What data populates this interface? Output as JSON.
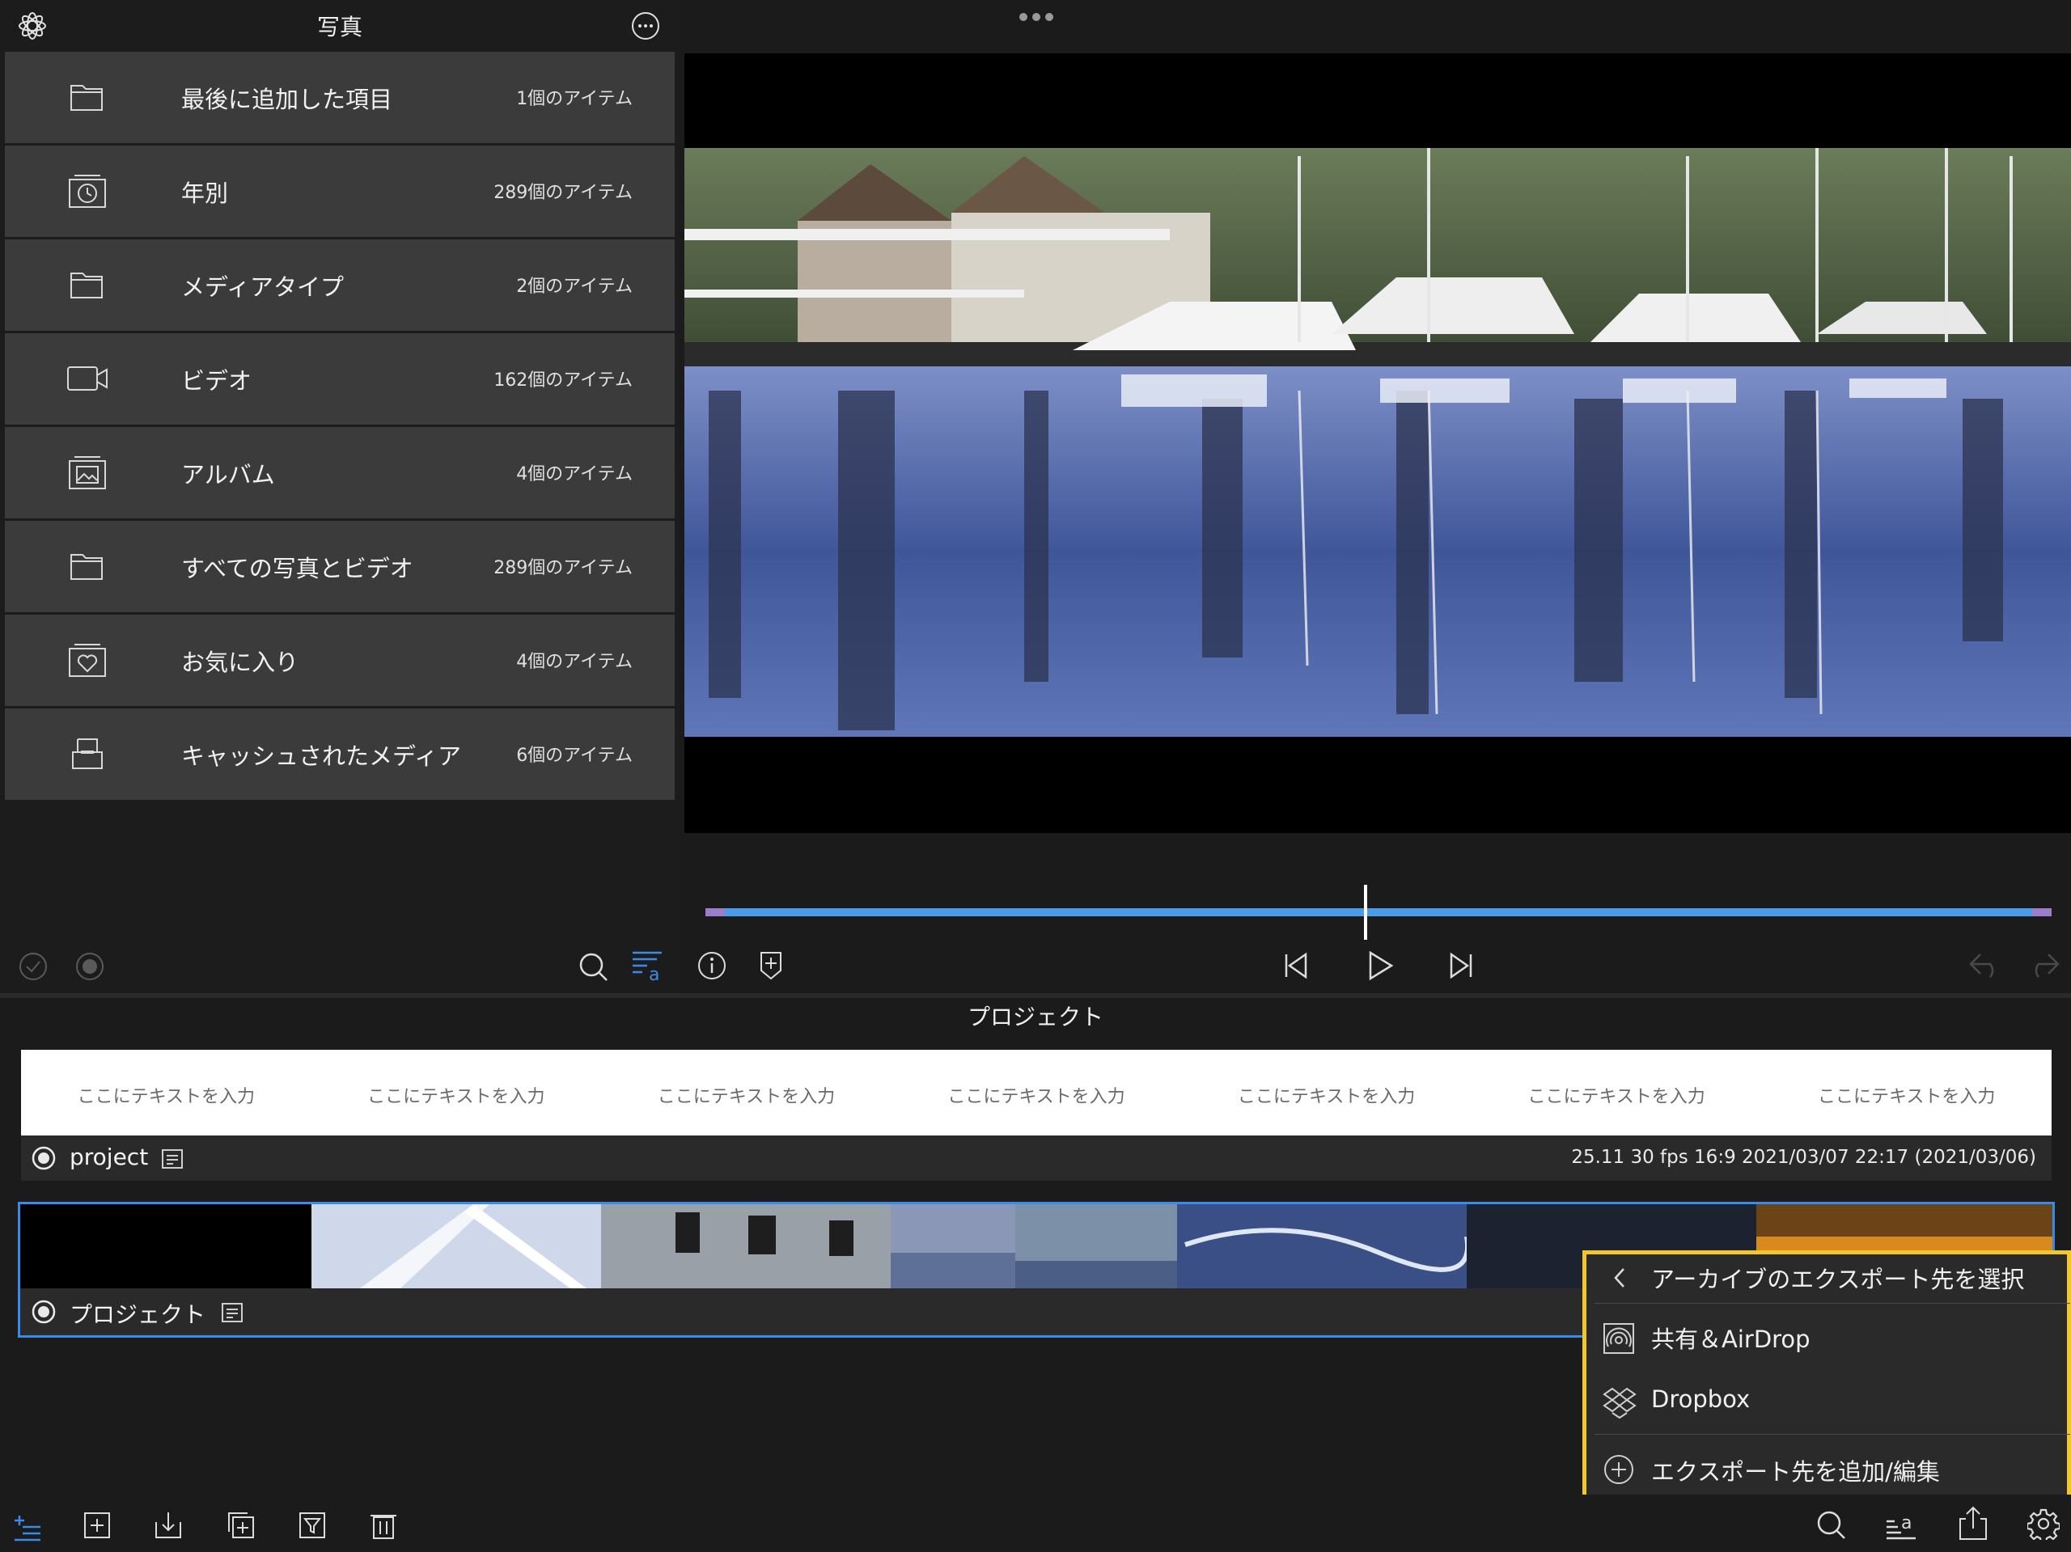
{
  "browser": {
    "title": "写真",
    "items": [
      {
        "label": "最後に追加した項目",
        "count": "1個のアイテム",
        "icon": "folder-icon"
      },
      {
        "label": "年別",
        "count": "289個のアイテム",
        "icon": "clock-stack-icon"
      },
      {
        "label": "メディアタイプ",
        "count": "2個のアイテム",
        "icon": "folder-icon"
      },
      {
        "label": "ビデオ",
        "count": "162個のアイテム",
        "icon": "video-camera-icon"
      },
      {
        "label": "アルバム",
        "count": "4個のアイテム",
        "icon": "photo-album-icon"
      },
      {
        "label": "すべての写真とビデオ",
        "count": "289個のアイテム",
        "icon": "folder-icon"
      },
      {
        "label": "お気に入り",
        "count": "4個のアイテム",
        "icon": "heart-stack-icon"
      },
      {
        "label": "キャッシュされたメディア",
        "count": "6個のアイテム",
        "icon": "tray-icon"
      }
    ]
  },
  "project": {
    "title": "プロジェクト",
    "title_strip": [
      "ここにテキストを入力",
      "ここにテキストを入力",
      "ここにテキストを入力",
      "ここにテキストを入力",
      "ここにテキストを入力",
      "ここにテキストを入力",
      "ここにテキストを入力"
    ],
    "row1": {
      "name": "project",
      "meta": "25.11   30 fps   16:9   2021/03/07 22:17   (2021/03/06)"
    },
    "row2": {
      "name": "プロジェクト"
    }
  },
  "export_popover": {
    "header": "アーカイブのエクスポート先を選択",
    "share": "共有＆AirDrop",
    "dropbox": "Dropbox",
    "add_edit": "エクスポート先を追加/編集"
  },
  "colors": {
    "accent": "#3a8be8",
    "highlight": "#f2c72c",
    "range": "#9a7ecb"
  }
}
